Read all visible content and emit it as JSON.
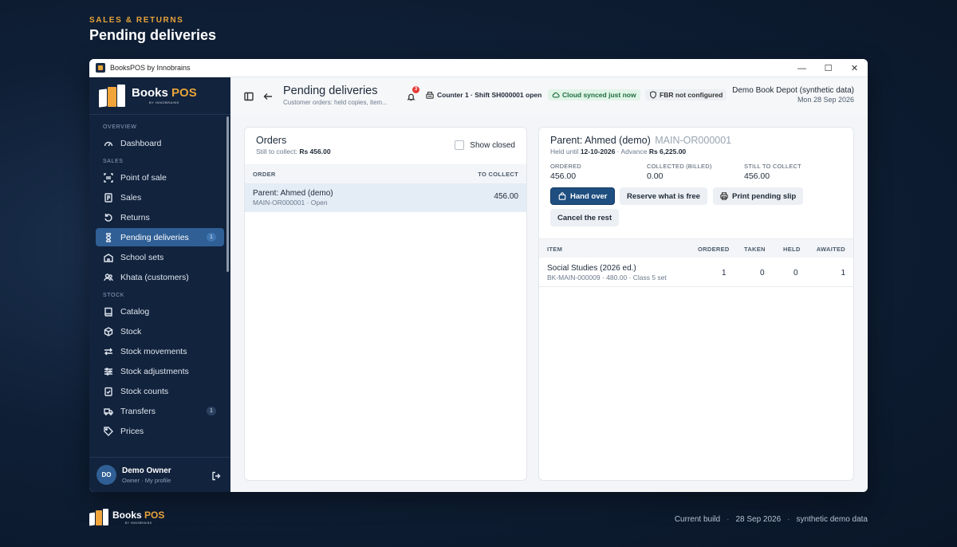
{
  "hero": {
    "kicker": "SALES & RETURNS",
    "title": "Pending deliveries"
  },
  "window": {
    "title": "BooksPOS by Innobrains",
    "controls": [
      "—",
      "☐",
      "✕"
    ]
  },
  "brand": {
    "name_main": "Books",
    "name_accent": "POS",
    "sub": "BY INNOBRAINS"
  },
  "nav": {
    "overview_label": "OVERVIEW",
    "sales_label": "SALES",
    "stock_label": "STOCK",
    "items": [
      {
        "label": "Dashboard",
        "icon": "gauge-icon"
      },
      {
        "label": "Point of sale",
        "icon": "barcode-scan-icon"
      },
      {
        "label": "Sales",
        "icon": "receipt-icon"
      },
      {
        "label": "Returns",
        "icon": "return-arrow-icon"
      },
      {
        "label": "Pending deliveries",
        "icon": "hourglass-icon",
        "badge": "1",
        "active": true
      },
      {
        "label": "School sets",
        "icon": "school-icon"
      },
      {
        "label": "Khata (customers)",
        "icon": "users-icon"
      },
      {
        "label": "Catalog",
        "icon": "book-icon"
      },
      {
        "label": "Stock",
        "icon": "box-icon"
      },
      {
        "label": "Stock movements",
        "icon": "arrows-swap-icon"
      },
      {
        "label": "Stock adjustments",
        "icon": "sliders-icon"
      },
      {
        "label": "Stock counts",
        "icon": "clipboard-check-icon"
      },
      {
        "label": "Transfers",
        "icon": "truck-icon",
        "badge": "1"
      },
      {
        "label": "Prices",
        "icon": "tag-icon"
      }
    ]
  },
  "user": {
    "initials": "DO",
    "name": "Demo Owner",
    "role": "Owner · My profile"
  },
  "header": {
    "title": "Pending deliveries",
    "subtitle": "Customer orders: held copies, item...",
    "notifications": "3",
    "counter": "Counter 1 · Shift SH000001 open",
    "sync": "Cloud synced just now",
    "fbr": "FBR not configured",
    "store_name": "Demo Book Depot (synthetic data)",
    "store_date": "Mon 28 Sep 2026"
  },
  "orders": {
    "title": "Orders",
    "sub_prefix": "Still to collect: ",
    "sub_amount": "Rs 456.00",
    "show_closed": "Show closed",
    "col_order": "ORDER",
    "col_collect": "TO COLLECT",
    "rows": [
      {
        "name": "Parent: Ahmed (demo)",
        "meta": "MAIN-OR000001 · Open",
        "amount": "456.00"
      }
    ]
  },
  "detail": {
    "title": "Parent: Ahmed (demo)",
    "code": "MAIN-OR000001",
    "held_prefix": "Held until ",
    "held_date": "12-10-2026",
    "advance_prefix": " · Advance ",
    "advance": "Rs 6,225.00",
    "stats": [
      {
        "label": "ORDERED",
        "value": "456.00"
      },
      {
        "label": "COLLECTED (BILLED)",
        "value": "0.00"
      },
      {
        "label": "STILL TO COLLECT",
        "value": "456.00"
      }
    ],
    "buttons": {
      "hand_over": "Hand over",
      "reserve": "Reserve what is free",
      "print": "Print pending slip",
      "cancel": "Cancel the rest"
    },
    "columns": [
      "ITEM",
      "ORDERED",
      "TAKEN",
      "HELD",
      "AWAITED"
    ],
    "items": [
      {
        "name": "Social Studies (2026 ed.)",
        "meta": "BK-MAIN-000009 · 480.00 · Class 5 set",
        "ordered": "1",
        "taken": "0",
        "held": "0",
        "awaited": "1"
      }
    ]
  },
  "footer": {
    "build": "Current build",
    "date": "28 Sep 2026",
    "note": "synthetic demo data",
    "sep": "·"
  },
  "colors": {
    "accent": "#e8a43a",
    "sidebar": "#12233d",
    "active": "#2f5f95",
    "primary_button": "#1f4e80",
    "sync_bg": "#e1f4e8"
  }
}
